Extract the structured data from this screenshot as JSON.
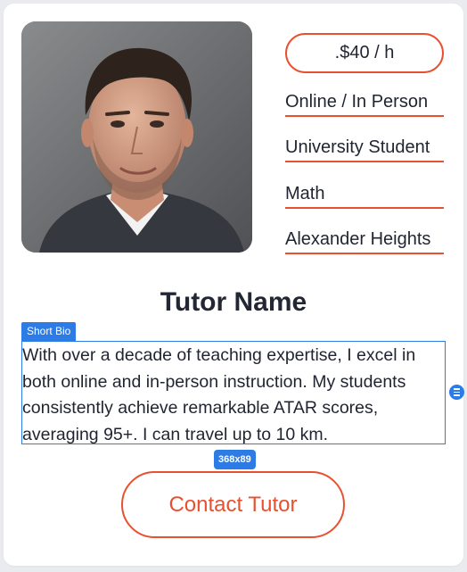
{
  "profile": {
    "rate": ".$40 / h",
    "mode": "Online / In Person",
    "level": "University Student",
    "subject": "Math",
    "location": "Alexander Heights",
    "name": "Tutor Name"
  },
  "editor": {
    "bio_tag": "Short Bio",
    "bio_size": "368x89"
  },
  "bio": {
    "text": "With over a decade of teaching expertise, I excel in both online and in-person instruction. My students consistently achieve remarkable ATAR scores, averaging 95+. I  can travel up to 10 km."
  },
  "actions": {
    "contact_label": "Contact Tutor"
  },
  "colors": {
    "accent": "#e8502f",
    "selection": "#2d7be5",
    "text": "#1f2430"
  }
}
